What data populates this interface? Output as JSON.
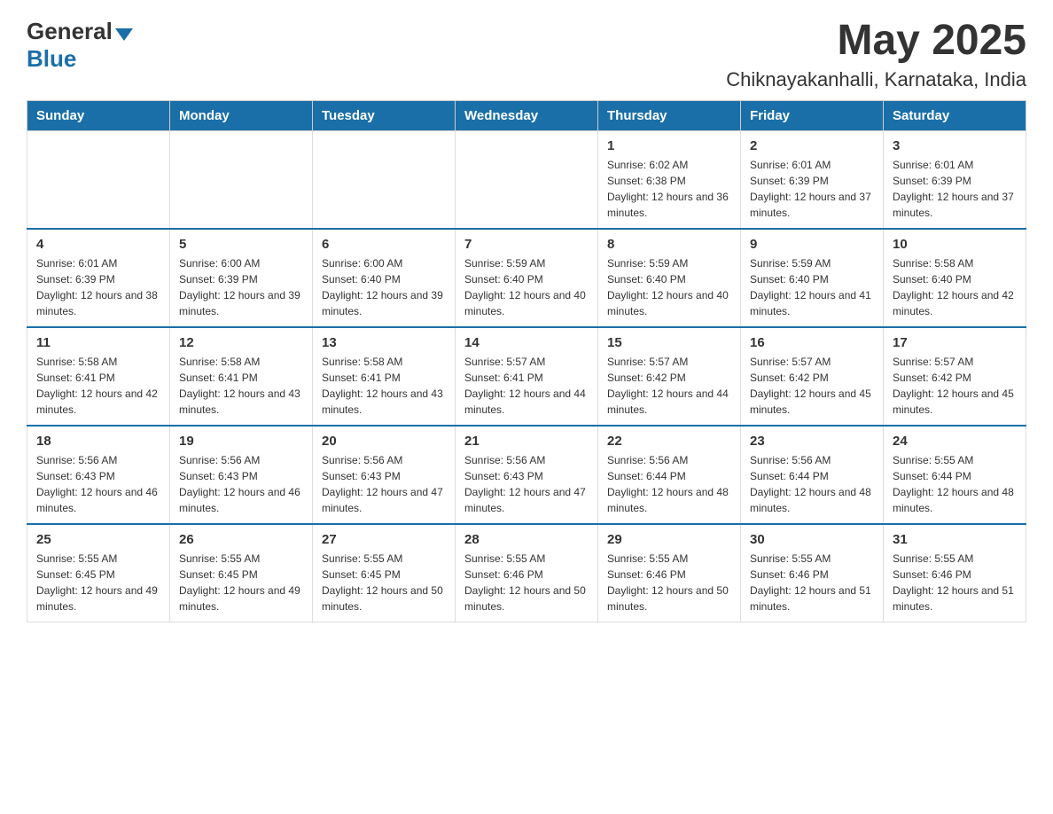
{
  "header": {
    "logo_general": "General",
    "logo_blue": "Blue",
    "title": "May 2025",
    "subtitle": "Chiknayakanhalli, Karnataka, India"
  },
  "days_of_week": [
    "Sunday",
    "Monday",
    "Tuesday",
    "Wednesday",
    "Thursday",
    "Friday",
    "Saturday"
  ],
  "weeks": [
    [
      {
        "day": "",
        "info": ""
      },
      {
        "day": "",
        "info": ""
      },
      {
        "day": "",
        "info": ""
      },
      {
        "day": "",
        "info": ""
      },
      {
        "day": "1",
        "info": "Sunrise: 6:02 AM\nSunset: 6:38 PM\nDaylight: 12 hours and 36 minutes."
      },
      {
        "day": "2",
        "info": "Sunrise: 6:01 AM\nSunset: 6:39 PM\nDaylight: 12 hours and 37 minutes."
      },
      {
        "day": "3",
        "info": "Sunrise: 6:01 AM\nSunset: 6:39 PM\nDaylight: 12 hours and 37 minutes."
      }
    ],
    [
      {
        "day": "4",
        "info": "Sunrise: 6:01 AM\nSunset: 6:39 PM\nDaylight: 12 hours and 38 minutes."
      },
      {
        "day": "5",
        "info": "Sunrise: 6:00 AM\nSunset: 6:39 PM\nDaylight: 12 hours and 39 minutes."
      },
      {
        "day": "6",
        "info": "Sunrise: 6:00 AM\nSunset: 6:40 PM\nDaylight: 12 hours and 39 minutes."
      },
      {
        "day": "7",
        "info": "Sunrise: 5:59 AM\nSunset: 6:40 PM\nDaylight: 12 hours and 40 minutes."
      },
      {
        "day": "8",
        "info": "Sunrise: 5:59 AM\nSunset: 6:40 PM\nDaylight: 12 hours and 40 minutes."
      },
      {
        "day": "9",
        "info": "Sunrise: 5:59 AM\nSunset: 6:40 PM\nDaylight: 12 hours and 41 minutes."
      },
      {
        "day": "10",
        "info": "Sunrise: 5:58 AM\nSunset: 6:40 PM\nDaylight: 12 hours and 42 minutes."
      }
    ],
    [
      {
        "day": "11",
        "info": "Sunrise: 5:58 AM\nSunset: 6:41 PM\nDaylight: 12 hours and 42 minutes."
      },
      {
        "day": "12",
        "info": "Sunrise: 5:58 AM\nSunset: 6:41 PM\nDaylight: 12 hours and 43 minutes."
      },
      {
        "day": "13",
        "info": "Sunrise: 5:58 AM\nSunset: 6:41 PM\nDaylight: 12 hours and 43 minutes."
      },
      {
        "day": "14",
        "info": "Sunrise: 5:57 AM\nSunset: 6:41 PM\nDaylight: 12 hours and 44 minutes."
      },
      {
        "day": "15",
        "info": "Sunrise: 5:57 AM\nSunset: 6:42 PM\nDaylight: 12 hours and 44 minutes."
      },
      {
        "day": "16",
        "info": "Sunrise: 5:57 AM\nSunset: 6:42 PM\nDaylight: 12 hours and 45 minutes."
      },
      {
        "day": "17",
        "info": "Sunrise: 5:57 AM\nSunset: 6:42 PM\nDaylight: 12 hours and 45 minutes."
      }
    ],
    [
      {
        "day": "18",
        "info": "Sunrise: 5:56 AM\nSunset: 6:43 PM\nDaylight: 12 hours and 46 minutes."
      },
      {
        "day": "19",
        "info": "Sunrise: 5:56 AM\nSunset: 6:43 PM\nDaylight: 12 hours and 46 minutes."
      },
      {
        "day": "20",
        "info": "Sunrise: 5:56 AM\nSunset: 6:43 PM\nDaylight: 12 hours and 47 minutes."
      },
      {
        "day": "21",
        "info": "Sunrise: 5:56 AM\nSunset: 6:43 PM\nDaylight: 12 hours and 47 minutes."
      },
      {
        "day": "22",
        "info": "Sunrise: 5:56 AM\nSunset: 6:44 PM\nDaylight: 12 hours and 48 minutes."
      },
      {
        "day": "23",
        "info": "Sunrise: 5:56 AM\nSunset: 6:44 PM\nDaylight: 12 hours and 48 minutes."
      },
      {
        "day": "24",
        "info": "Sunrise: 5:55 AM\nSunset: 6:44 PM\nDaylight: 12 hours and 48 minutes."
      }
    ],
    [
      {
        "day": "25",
        "info": "Sunrise: 5:55 AM\nSunset: 6:45 PM\nDaylight: 12 hours and 49 minutes."
      },
      {
        "day": "26",
        "info": "Sunrise: 5:55 AM\nSunset: 6:45 PM\nDaylight: 12 hours and 49 minutes."
      },
      {
        "day": "27",
        "info": "Sunrise: 5:55 AM\nSunset: 6:45 PM\nDaylight: 12 hours and 50 minutes."
      },
      {
        "day": "28",
        "info": "Sunrise: 5:55 AM\nSunset: 6:46 PM\nDaylight: 12 hours and 50 minutes."
      },
      {
        "day": "29",
        "info": "Sunrise: 5:55 AM\nSunset: 6:46 PM\nDaylight: 12 hours and 50 minutes."
      },
      {
        "day": "30",
        "info": "Sunrise: 5:55 AM\nSunset: 6:46 PM\nDaylight: 12 hours and 51 minutes."
      },
      {
        "day": "31",
        "info": "Sunrise: 5:55 AM\nSunset: 6:46 PM\nDaylight: 12 hours and 51 minutes."
      }
    ]
  ]
}
